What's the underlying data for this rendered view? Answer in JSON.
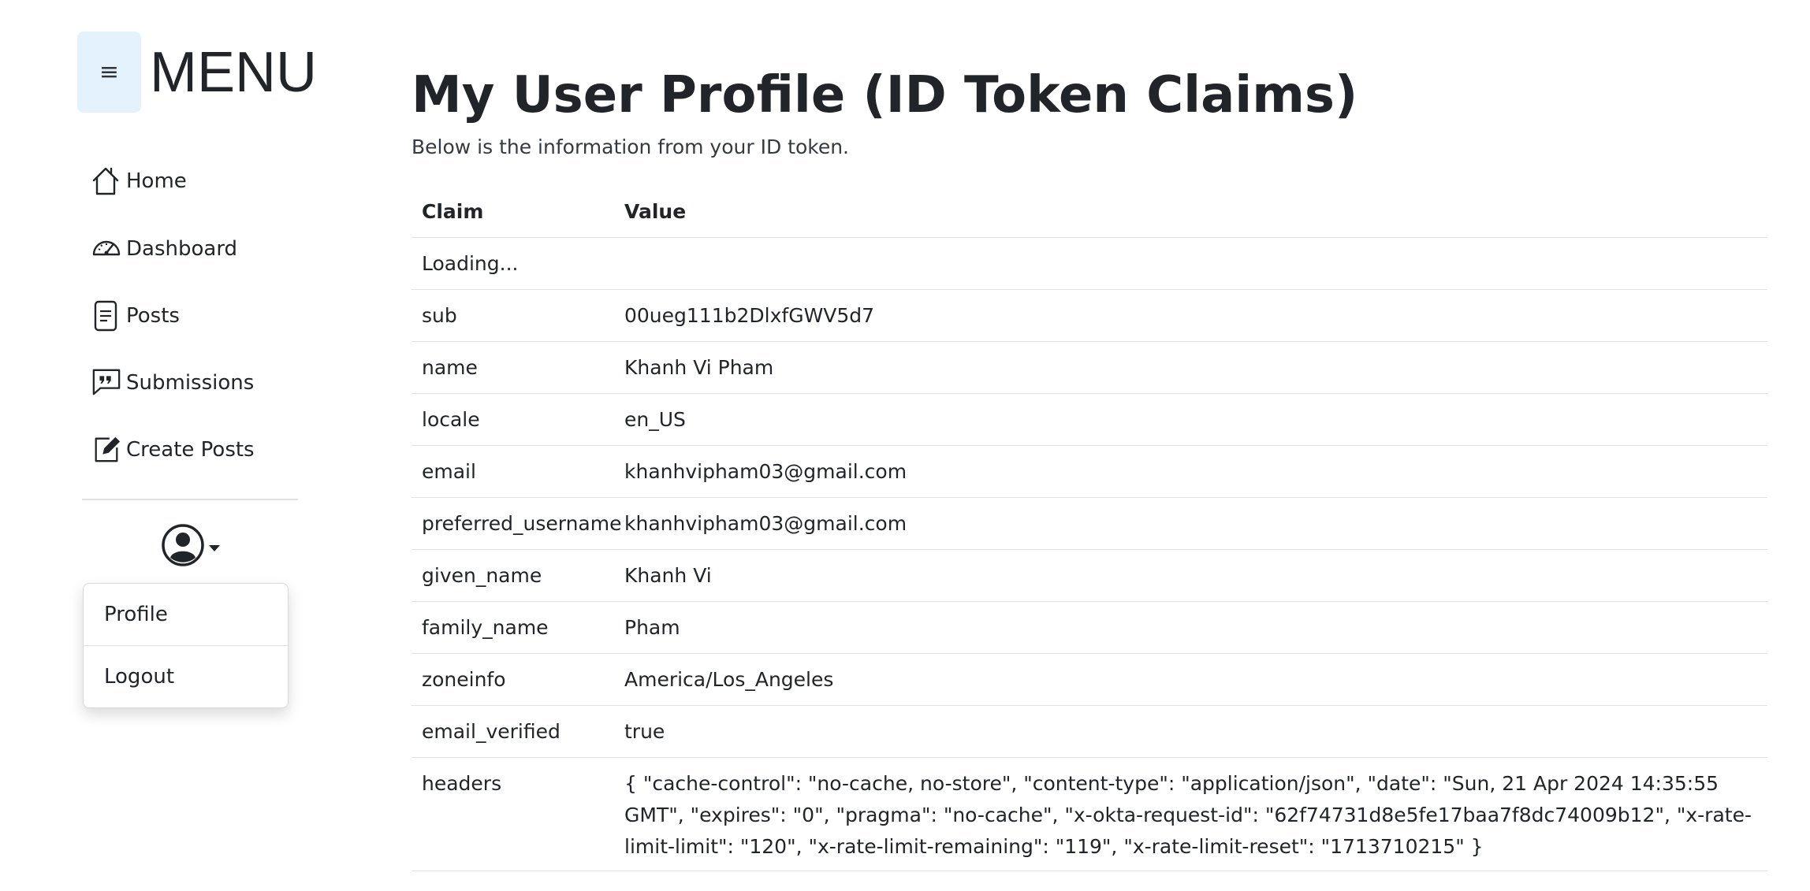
{
  "sidebar": {
    "menu_toggle_glyph": "≡",
    "title": "MENU",
    "nav": [
      {
        "label": "Home",
        "icon": "house-icon"
      },
      {
        "label": "Dashboard",
        "icon": "speedometer-icon"
      },
      {
        "label": "Posts",
        "icon": "file-text-icon"
      },
      {
        "label": "Submissions",
        "icon": "chat-quote-icon"
      },
      {
        "label": "Create Posts",
        "icon": "pencil-square-icon"
      }
    ],
    "user_menu": {
      "icon": "person-circle-icon",
      "items": [
        "Profile",
        "Logout"
      ]
    }
  },
  "main": {
    "title": "My User Profile (ID Token Claims)",
    "subtitle": "Below is the information from your ID token.",
    "table": {
      "columns": [
        "Claim",
        "Value"
      ],
      "loading": "Loading...",
      "rows": [
        {
          "claim": "sub",
          "value": "00ueg111b2DlxfGWV5d7"
        },
        {
          "claim": "name",
          "value": "Khanh Vi Pham"
        },
        {
          "claim": "locale",
          "value": "en_US"
        },
        {
          "claim": "email",
          "value": "khanhvipham03@gmail.com"
        },
        {
          "claim": "preferred_username",
          "value": "khanhvipham03@gmail.com"
        },
        {
          "claim": "given_name",
          "value": "Khanh Vi"
        },
        {
          "claim": "family_name",
          "value": "Pham"
        },
        {
          "claim": "zoneinfo",
          "value": "America/Los_Angeles"
        },
        {
          "claim": "email_verified",
          "value": "true"
        },
        {
          "claim": "headers",
          "value": "{ \"cache-control\": \"no-cache, no-store\", \"content-type\": \"application/json\", \"date\": \"Sun, 21 Apr 2024 14:35:55 GMT\", \"expires\": \"0\", \"pragma\": \"no-cache\", \"x-okta-request-id\": \"62f74731d8e5fe17baa7f8dc74009b12\", \"x-rate-limit-limit\": \"120\", \"x-rate-limit-remaining\": \"119\", \"x-rate-limit-reset\": \"1713710215\" }"
        }
      ]
    }
  }
}
